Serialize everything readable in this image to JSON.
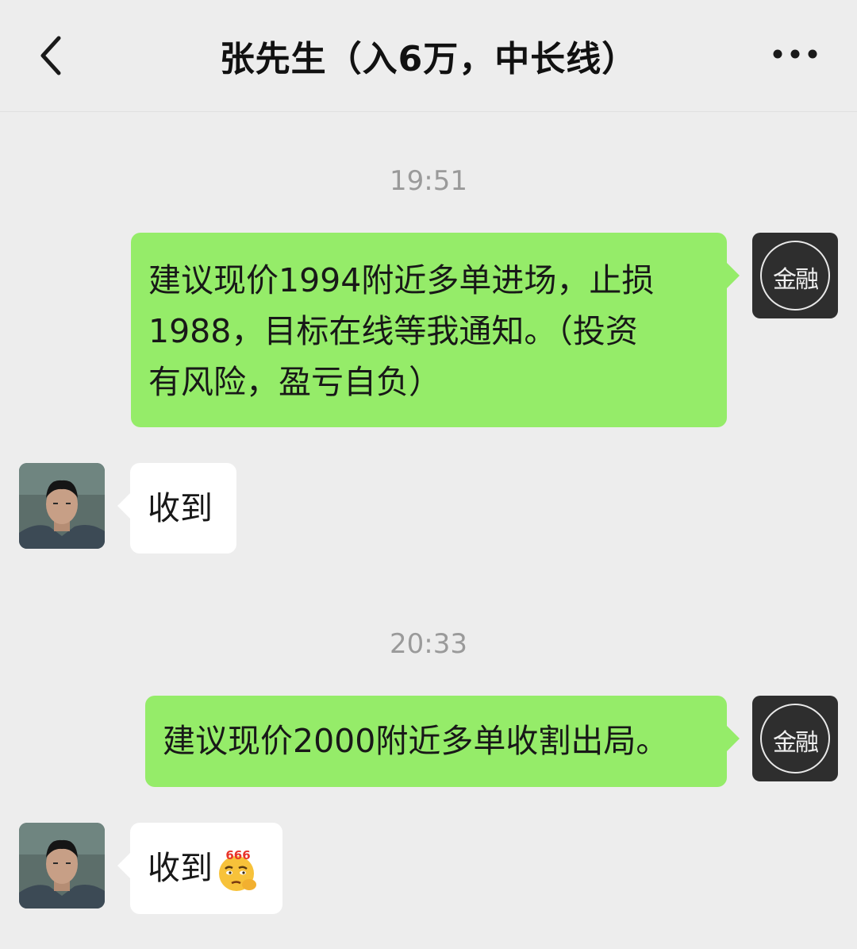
{
  "header": {
    "title": "张先生（入6万，中长线）"
  },
  "messages": [
    {
      "time": "19:51"
    },
    {
      "sender": "self",
      "avatar_text": "金融",
      "lines": [
        "建议现价1994附近多单进场，止损",
        "1988，目标在线等我通知。（投资",
        "有风险，盈亏自负）"
      ]
    },
    {
      "sender": "contact",
      "text": "收到"
    },
    {
      "time": "20:33"
    },
    {
      "sender": "self",
      "avatar_text": "金融",
      "text": "建议现价2000附近多单收割出局。"
    },
    {
      "sender": "contact",
      "text": "收到",
      "emoji_label": "666"
    }
  ],
  "colors": {
    "background": "#ededed",
    "outgoing_bubble": "#95ec69",
    "incoming_bubble": "#ffffff",
    "timestamp": "#9a9a9a"
  },
  "icons": [
    "back-chevron-icon",
    "more-dots-icon",
    "thinking-666-emoji"
  ]
}
